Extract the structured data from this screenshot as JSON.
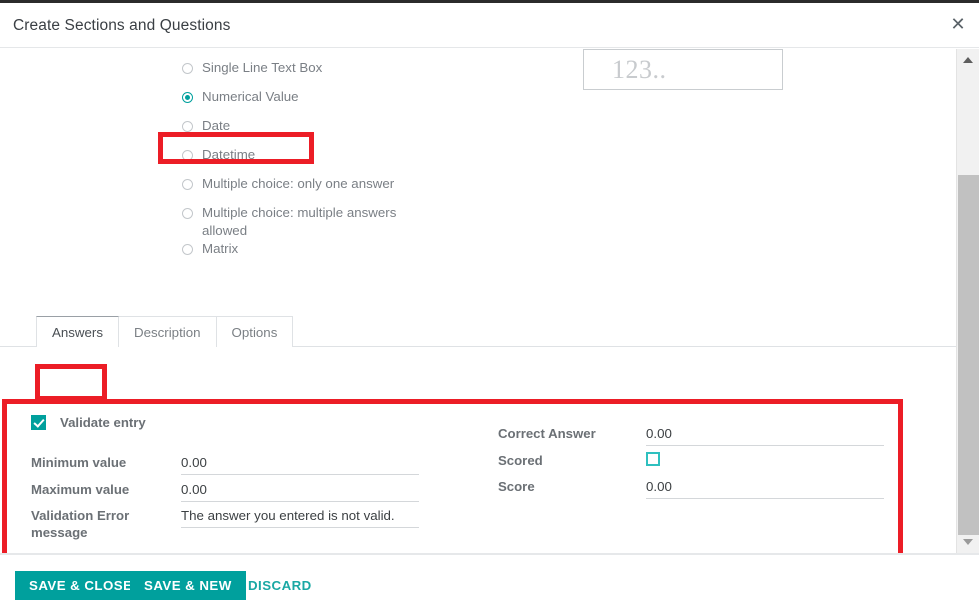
{
  "modal": {
    "title": "Create Sections and Questions",
    "close_icon": "close-icon",
    "close_glyph": "✕"
  },
  "question_types": {
    "options": [
      {
        "label": "Single Line Text Box",
        "selected": false
      },
      {
        "label": "Numerical Value",
        "selected": true
      },
      {
        "label": "Date",
        "selected": false
      },
      {
        "label": "Datetime",
        "selected": false
      },
      {
        "label": "Multiple choice: only one answer",
        "selected": false
      },
      {
        "label": "Multiple choice: multiple answers allowed",
        "selected": false
      },
      {
        "label": "Matrix",
        "selected": false
      }
    ]
  },
  "preview": {
    "placeholder_text": "123.."
  },
  "tabs": [
    {
      "label": "Answers",
      "active": true
    },
    {
      "label": "Description",
      "active": false
    },
    {
      "label": "Options",
      "active": false
    }
  ],
  "answers_form": {
    "validate_entry": {
      "label": "Validate entry",
      "checked": true
    },
    "left_fields": [
      {
        "label": "Minimum value",
        "value": "0.00"
      },
      {
        "label": "Maximum value",
        "value": "0.00"
      },
      {
        "label": "Validation Error message",
        "value": "The answer you entered is not valid."
      }
    ],
    "right_fields": [
      {
        "label": "Correct Answer",
        "value": "0.00"
      },
      {
        "label": "Score",
        "value": "0.00"
      }
    ],
    "scored": {
      "label": "Scored",
      "checked": false
    }
  },
  "footer": {
    "save_close_label": "SAVE & CLOSE",
    "save_new_label": "SAVE & NEW",
    "discard_label": "DISCARD"
  },
  "scrollbar": {
    "up_icon": "chevron-up-icon",
    "down_icon": "chevron-down-icon"
  },
  "colors": {
    "accent_teal": "#00a09d",
    "highlight_red": "#ec1d26",
    "checkbox_outline": "#2fc0bf",
    "label_gray": "#6b7075"
  }
}
